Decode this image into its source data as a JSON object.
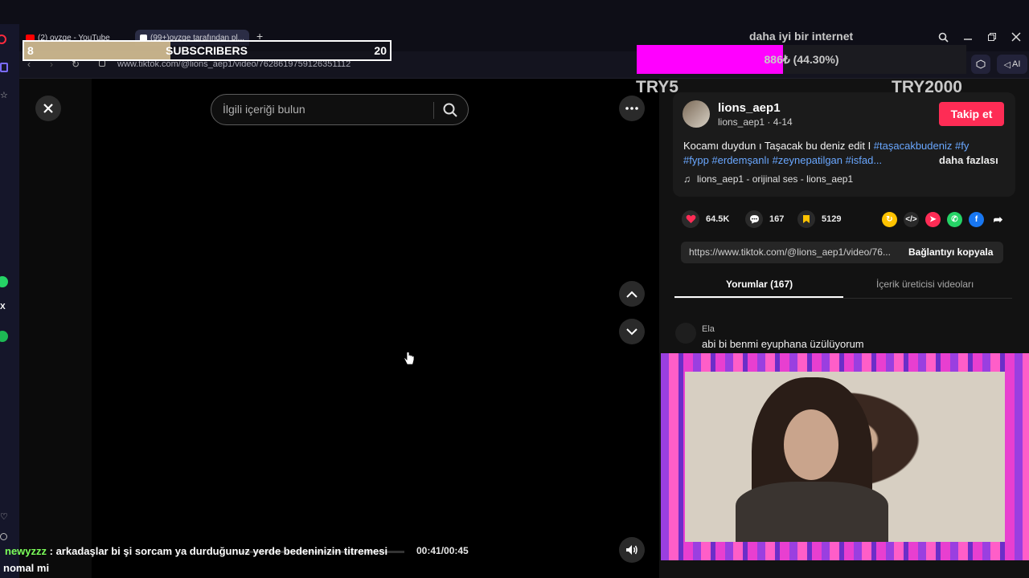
{
  "browser": {
    "tabs": [
      {
        "label": "(2) ovzge - YouTube"
      },
      {
        "label": "(99+)ovzge tarafından pl..."
      }
    ],
    "new_tab_symbol": "+",
    "url": "www.tiktok.com/@lions_aep1/video/7628619759126351112",
    "ai_label": "AI"
  },
  "overlay": {
    "subs_current": "8",
    "subs_label": "SUBSCRIBERS",
    "subs_goal": "20",
    "subs_progress": 0.4,
    "net_label": "daha iyi bir internet",
    "progress_text": "886₺ (44.30%)",
    "progress_fraction": 0.443,
    "try_left": "TRY5",
    "try_right": "TRY2000",
    "accent": "#ff00ff"
  },
  "player": {
    "search_placeholder": "İlgili içeriği bulun",
    "time": "00:41/00:45"
  },
  "post": {
    "username": "lions_aep1",
    "handle": "lions_aep1 · 4-14",
    "follow": "Takip et",
    "caption_text": "Kocamı duydun ı Taşacak bu deniz edit I ",
    "tags_line1": "#taşacakbudeniz #fy",
    "tags_line2": "#fypp #erdemşanlı #zeynepatilgan #isfad...",
    "more": "daha fazlası",
    "music": "lions_aep1 - orijinal ses - lions_aep1",
    "likes": "64.5K",
    "comments": "167",
    "saves": "5129",
    "link_url": "https://www.tiktok.com/@lions_aep1/video/76...",
    "copy_link": "Bağlantıyı kopyala",
    "tab_comments": "Yorumlar (167)",
    "tab_creator": "İçerik üreticisi videoları",
    "comment_user": "Ela",
    "comment_text": "abi bi benmi eyuphana üzülüyorum",
    "brand_color": "#fe2c55"
  },
  "chat": {
    "user": "newyzzz",
    "message": " : arkadaşlar bi şi sorcam ya durduğunuz yerde bedeninizin titremesi",
    "message_cont": "nomal mi"
  }
}
